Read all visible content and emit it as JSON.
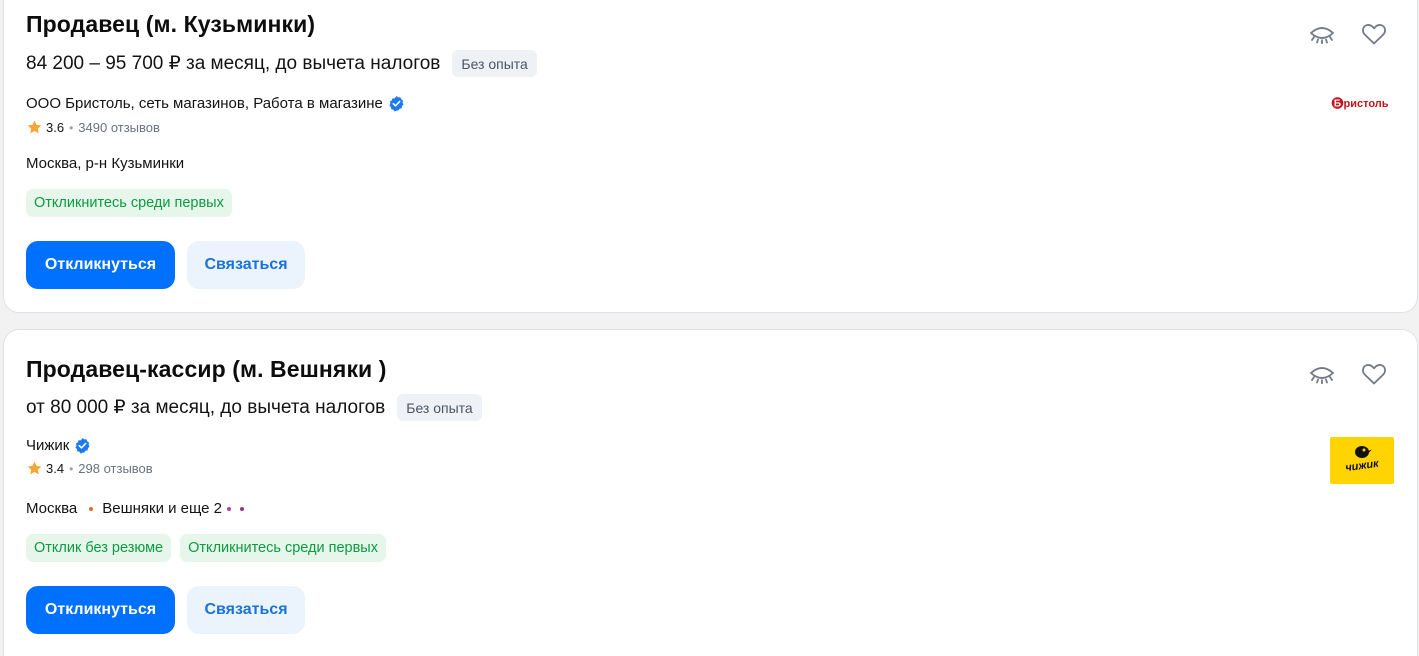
{
  "vacancies": [
    {
      "title": "Продавец (м. Кузьминки)",
      "salary": "84 200 – 95 700 ₽ за месяц, до вычета налогов",
      "experience": "Без опыта",
      "company": "ООО Бристоль, сеть магазинов, Работа в магазине",
      "rating": "3.6",
      "reviews": "3490 отзывов",
      "location": "Москва, р-н Кузьминки",
      "tags": [
        "Откликнитесь среди первых"
      ],
      "respond_label": "Откликнуться",
      "contact_label": "Связаться",
      "logo_text": "Бристоль"
    },
    {
      "title": "Продавец-кассир (м. Вешняки )",
      "salary": "от 80 000 ₽ за месяц, до вычета налогов",
      "experience": "Без опыта",
      "company": "Чижик",
      "rating": "3.4",
      "reviews": "298 отзывов",
      "location_city": "Москва",
      "location_metro": "Вешняки и еще 2",
      "tags": [
        "Отклик без резюме",
        "Откликнитесь среди первых"
      ],
      "respond_label": "Откликнуться",
      "contact_label": "Связаться",
      "logo_text": "чижик"
    }
  ],
  "colors": {
    "primary_button": "#0070ff",
    "secondary_button_bg": "#ebf3fd",
    "tag_bg": "#e6f6ea",
    "tag_text": "#0c9b40",
    "verified": "#1a7cf0",
    "star": "#f6a635",
    "bristol_logo": "#c2161e",
    "chizhik_logo_bg": "#ffd400"
  },
  "icons": [
    "hide-vacancy-icon",
    "favorite-heart-icon",
    "verified-icon",
    "star-icon"
  ]
}
